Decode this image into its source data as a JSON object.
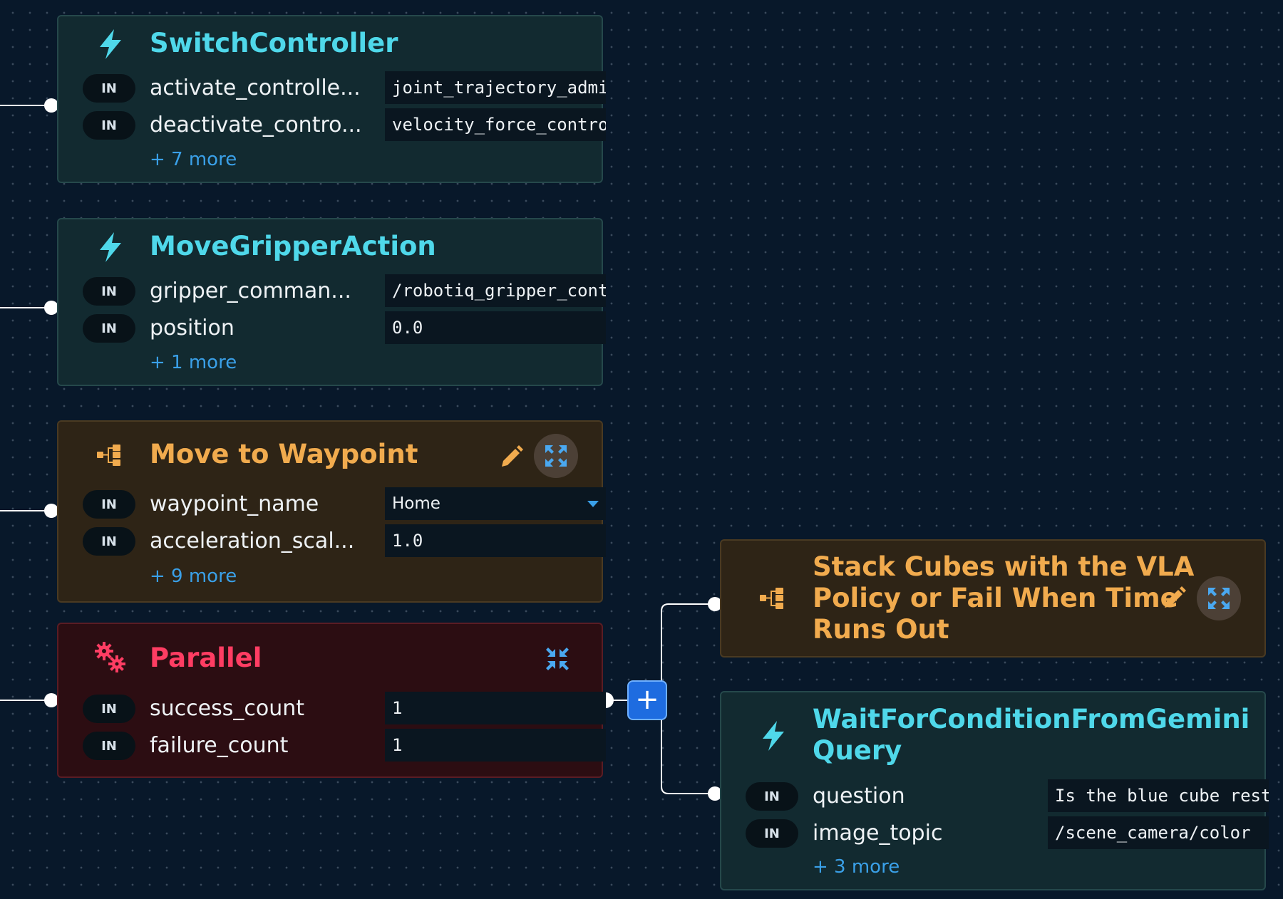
{
  "nodes": {
    "switch": {
      "title": "SwitchController",
      "ports": [
        {
          "dir": "IN",
          "name": "activate_controlle...",
          "value": "joint_trajectory_admi"
        },
        {
          "dir": "IN",
          "name": "deactivate_contro...",
          "value": "velocity_force_contro"
        }
      ],
      "more": "+ 7 more"
    },
    "gripper": {
      "title": "MoveGripperAction",
      "ports": [
        {
          "dir": "IN",
          "name": "gripper_comman...",
          "value": "/robotiq_gripper_cont"
        },
        {
          "dir": "IN",
          "name": "position",
          "value": "0.0"
        }
      ],
      "more": "+ 1 more"
    },
    "waypoint": {
      "title": "Move to Waypoint",
      "ports": [
        {
          "dir": "IN",
          "name": "waypoint_name",
          "value": "Home"
        },
        {
          "dir": "IN",
          "name": "acceleration_scal...",
          "value": "1.0"
        }
      ],
      "more": "+ 9 more"
    },
    "parallel": {
      "title": "Parallel",
      "ports": [
        {
          "dir": "IN",
          "name": "success_count",
          "value": "1"
        },
        {
          "dir": "IN",
          "name": "failure_count",
          "value": "1"
        }
      ]
    },
    "stack": {
      "title_lines": [
        "Stack Cubes with the VLA",
        "Policy or Fail When Time",
        "Runs Out"
      ]
    },
    "wait": {
      "title_lines": [
        "WaitForConditionFromGemini",
        "Query"
      ],
      "ports": [
        {
          "dir": "IN",
          "name": "question",
          "value": "Is the blue cube rest:"
        },
        {
          "dir": "IN",
          "name": "image_topic",
          "value": "/scene_camera/color"
        }
      ],
      "more": "+ 3 more"
    }
  },
  "add_button_label": "+",
  "colors": {
    "skill_title": "#4fd8ea",
    "subtree_title": "#f1ab4e",
    "parallel_title": "#ff3d63",
    "link": "#3aa0e8"
  }
}
